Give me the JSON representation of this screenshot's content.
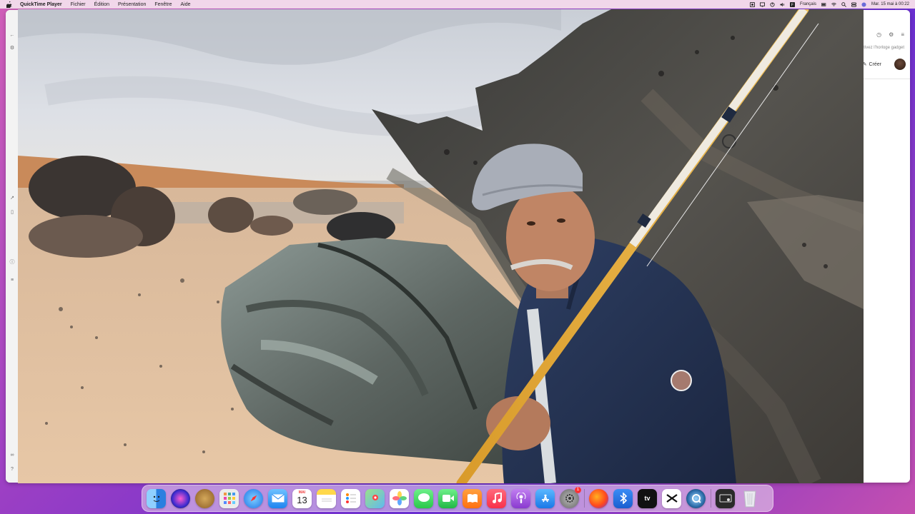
{
  "menubar": {
    "app_name": "QuickTime Player",
    "menus": [
      "Fichier",
      "Édition",
      "Présentation",
      "Fenêtre",
      "Aide"
    ],
    "input_source": "Français",
    "datetime": "Mar. 15 mai à 00:22"
  },
  "background_window": {
    "hint_text": "Activez l’horloge gadget",
    "create_label": "Créer"
  },
  "video": {
    "description_icon": "video-frame"
  },
  "dock": {
    "calendar_month": "MAI",
    "calendar_day": "13",
    "settings_badge": "1",
    "apps": [
      {
        "name": "finder",
        "color": "#3b8ef0"
      },
      {
        "name": "siri",
        "color": "#5b2bd0"
      },
      {
        "name": "archive",
        "color": "#b78a3e"
      },
      {
        "name": "launchpad",
        "color": "#e8e8e8"
      },
      {
        "name": "safari",
        "color": "#2c8cf2"
      },
      {
        "name": "mail",
        "color": "#3a9af5"
      },
      {
        "name": "calendar",
        "color": "#ffffff"
      },
      {
        "name": "notes",
        "color": "#ffd84a"
      },
      {
        "name": "reminders",
        "color": "#ffffff"
      },
      {
        "name": "maps",
        "color": "#6fc36a"
      },
      {
        "name": "photos",
        "color": "#ffffff"
      },
      {
        "name": "messages",
        "color": "#3dd35a"
      },
      {
        "name": "facetime",
        "color": "#2fcd4f"
      },
      {
        "name": "books",
        "color": "#ff8a1c"
      },
      {
        "name": "music",
        "color": "#fa3a55"
      },
      {
        "name": "podcasts",
        "color": "#9d4ed6"
      },
      {
        "name": "app-store",
        "color": "#2a8cf3"
      },
      {
        "name": "system-settings",
        "color": "#8a8a8a"
      },
      {
        "name": "firefox",
        "color": "#ff7b1c"
      },
      {
        "name": "bluetooth",
        "color": "#1a73e8"
      },
      {
        "name": "apple-tv",
        "color": "#111111"
      },
      {
        "name": "capcut",
        "color": "#ffffff"
      },
      {
        "name": "quicktime",
        "color": "#2f3b44"
      },
      {
        "name": "screen-recorder",
        "color": "#333333"
      },
      {
        "name": "trash",
        "color": "#e8e8ee"
      }
    ]
  }
}
